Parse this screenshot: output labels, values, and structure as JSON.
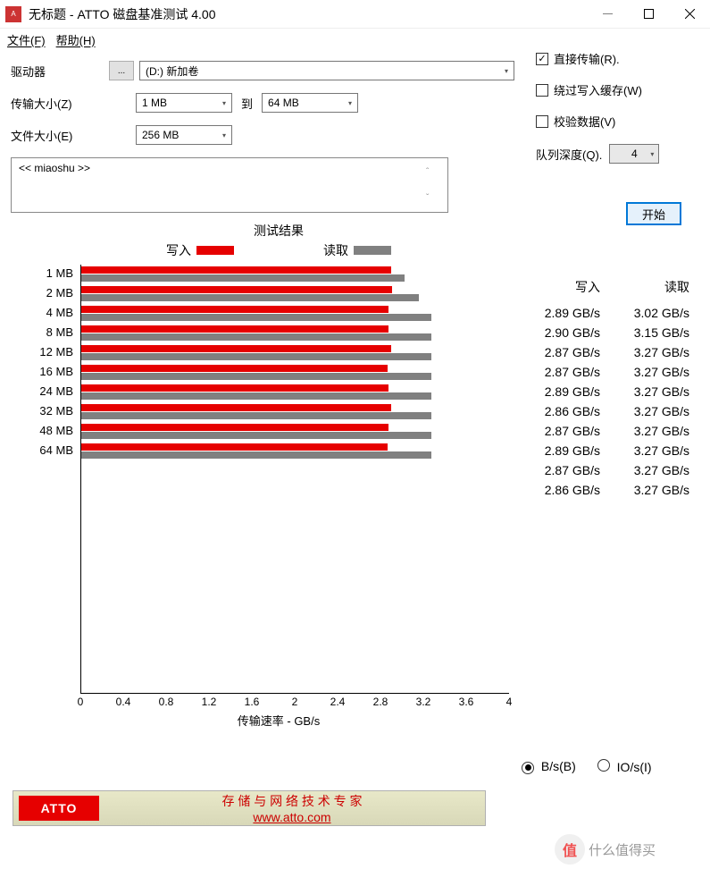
{
  "window": {
    "title": "无标题 - ATTO 磁盘基准测试 4.00"
  },
  "menu": {
    "file": "文件(F)",
    "help": "帮助(H)"
  },
  "form": {
    "drive_label": "驱动器",
    "browse": "...",
    "drive_value": "(D:) 新加卷",
    "transfer_label": "传输大小(Z)",
    "transfer_from": "1 MB",
    "to_label": "到",
    "transfer_to": "64 MB",
    "file_label": "文件大小(E)",
    "file_value": "256 MB"
  },
  "options": {
    "direct": "直接传输(R).",
    "bypass": "绕过写入缓存(W)",
    "verify": "校验数据(V)",
    "queue_label": "队列深度(Q).",
    "queue_value": "4"
  },
  "desc": {
    "text": "<< miaoshu >>"
  },
  "start": "开始",
  "chart": {
    "title": "测试结果",
    "write_legend": "写入",
    "read_legend": "读取",
    "xlabel": "传输速率 - GB/s"
  },
  "chart_data": {
    "type": "bar",
    "categories": [
      "1 MB",
      "2 MB",
      "4 MB",
      "8 MB",
      "12 MB",
      "16 MB",
      "24 MB",
      "32 MB",
      "48 MB",
      "64 MB"
    ],
    "series": [
      {
        "name": "写入",
        "values": [
          2.89,
          2.9,
          2.87,
          2.87,
          2.89,
          2.86,
          2.87,
          2.89,
          2.87,
          2.86
        ]
      },
      {
        "name": "读取",
        "values": [
          3.02,
          3.15,
          3.27,
          3.27,
          3.27,
          3.27,
          3.27,
          3.27,
          3.27,
          3.27
        ]
      }
    ],
    "xlim": [
      0,
      4
    ],
    "xticks": [
      0,
      0.4,
      0.8,
      1.2,
      1.6,
      2,
      2.4,
      2.8,
      3.2,
      3.6,
      4
    ],
    "xlabel": "传输速率 - GB/s",
    "unit": "GB/s"
  },
  "results": {
    "write_header": "写入",
    "read_header": "读取"
  },
  "units": {
    "bs": "B/s(B)",
    "ios": "IO/s(I)"
  },
  "footer": {
    "logo": "ATTO",
    "line1": "存 储 与 网 络 技 术 专 家",
    "url": "www.atto.com"
  },
  "watermark": "什么值得买"
}
